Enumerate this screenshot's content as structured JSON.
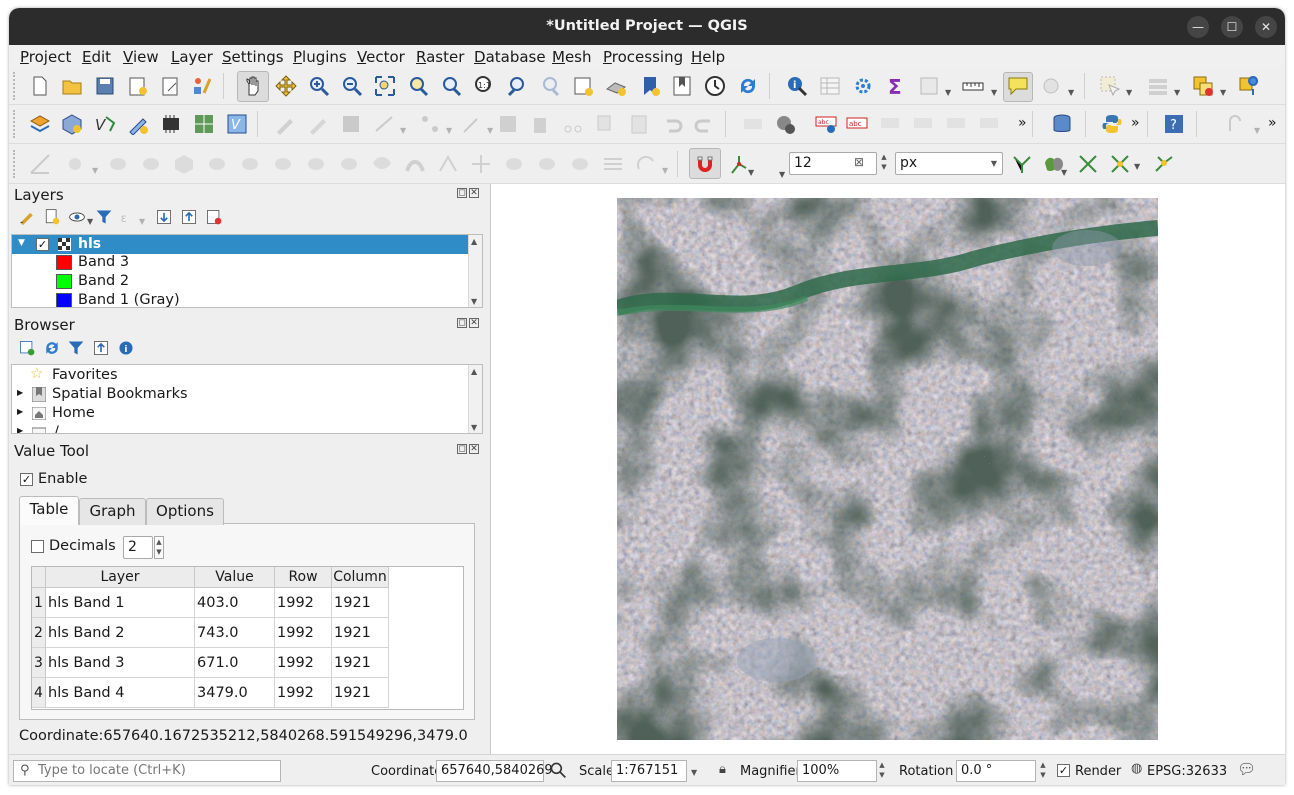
{
  "window": {
    "title": "*Untitled Project — QGIS"
  },
  "menu": [
    "Project",
    "Edit",
    "View",
    "Layer",
    "Settings",
    "Plugins",
    "Vector",
    "Raster",
    "Database",
    "Mesh",
    "Processing",
    "Help"
  ],
  "snapping": {
    "tolerance": "12",
    "unit": "px"
  },
  "layers_panel": {
    "title": "Layers",
    "layer": {
      "name": "hls",
      "checked": true
    },
    "bands": [
      {
        "label": "Band 3",
        "color": "#ff0000"
      },
      {
        "label": "Band 2",
        "color": "#00ff00"
      },
      {
        "label": "Band 1 (Gray)",
        "color": "#0000ff"
      }
    ]
  },
  "browser_panel": {
    "title": "Browser",
    "items": [
      "Favorites",
      "Spatial Bookmarks",
      "Home",
      "/"
    ]
  },
  "value_tool": {
    "title": "Value Tool",
    "enable_label": "Enable",
    "tabs": [
      "Table",
      "Graph",
      "Options"
    ],
    "decimals_label": "Decimals",
    "decimals_value": "2",
    "columns": [
      "Layer",
      "Value",
      "Row",
      "Column"
    ],
    "rows": [
      {
        "n": "1",
        "layer": "hls Band 1",
        "value": "403.0",
        "row": "1992",
        "column": "1921"
      },
      {
        "n": "2",
        "layer": "hls Band 2",
        "value": "743.0",
        "row": "1992",
        "column": "1921"
      },
      {
        "n": "3",
        "layer": "hls Band 3",
        "value": "671.0",
        "row": "1992",
        "column": "1921"
      },
      {
        "n": "4",
        "layer": "hls Band 4",
        "value": "3479.0",
        "row": "1992",
        "column": "1921"
      }
    ],
    "coordinate_text": "Coordinate:657640.1672535212,5840268.591549296,3479.0"
  },
  "statusbar": {
    "locate_placeholder": "Type to locate (Ctrl+K)",
    "coordinate_label": "Coordinate",
    "coordinate_value": "657640,5840269",
    "scale_label": "Scale",
    "scale_value": "1:767151",
    "magnifier_label": "Magnifier",
    "magnifier_value": "100%",
    "rotation_label": "Rotation",
    "rotation_value": "0.0 °",
    "render_label": "Render",
    "crs": "EPSG:32633"
  },
  "colors": {
    "selection": "#308cc6",
    "titlebar": "#2c2c2c"
  }
}
